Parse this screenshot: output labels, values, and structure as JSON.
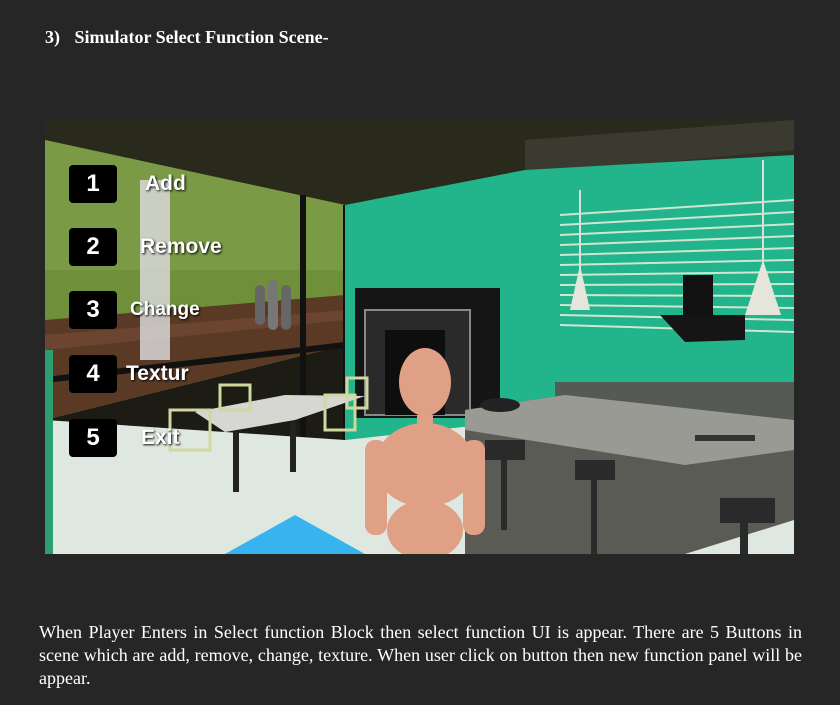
{
  "heading": {
    "number": "3)",
    "title": "Simulator Select Function Scene-"
  },
  "menu": {
    "items": [
      {
        "number": "1",
        "label": "Add"
      },
      {
        "number": "2",
        "label": "Remove"
      },
      {
        "number": "3",
        "label": "Change"
      },
      {
        "number": "4",
        "label": "Textur"
      },
      {
        "number": "5",
        "label": "Exit"
      }
    ]
  },
  "caption": "When Player Enters in Select function Block then select function UI is appear. There are 5 Buttons in scene which are add, remove, change, texture. When user click on button then new function panel will be appear.",
  "colors": {
    "page_background": "#262626",
    "wall_green": "#22b48a",
    "button_background": "#000000",
    "text": "#ffffff"
  }
}
